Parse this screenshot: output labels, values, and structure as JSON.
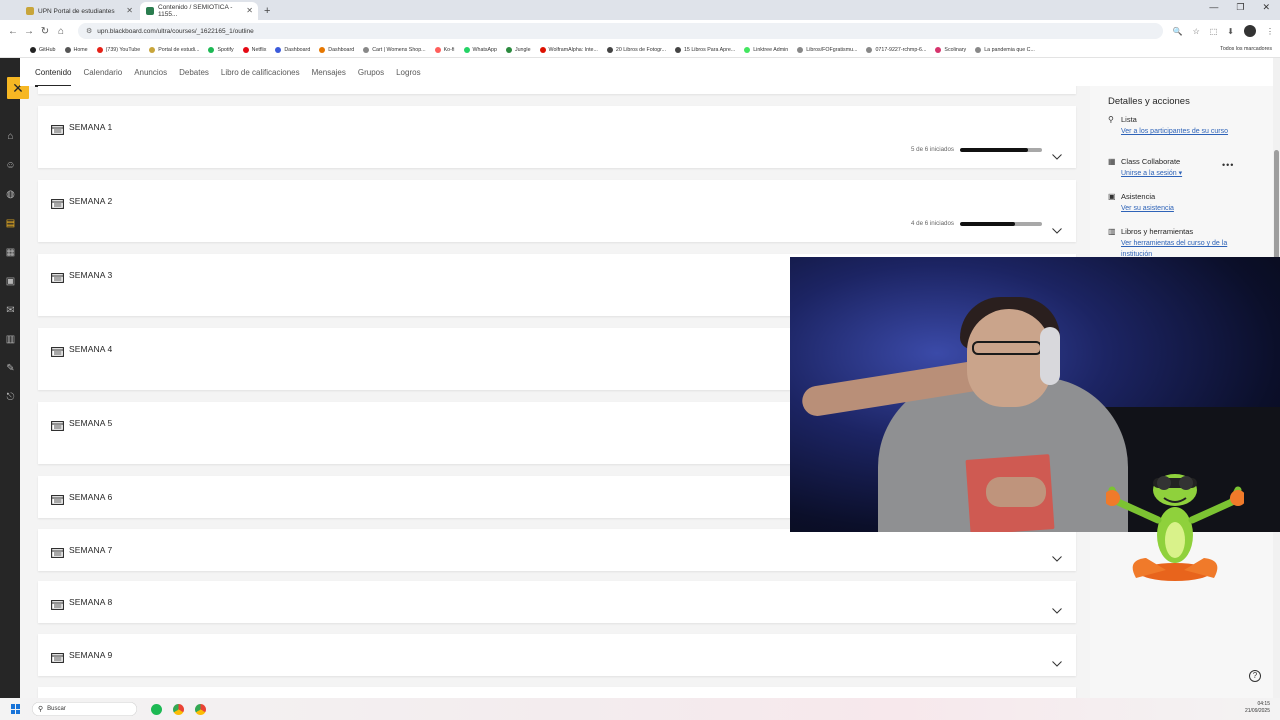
{
  "browser": {
    "tabs": [
      {
        "title": "UPN Portal de estudiantes",
        "color": "#c8a53a"
      },
      {
        "title": "Contenido / SEMIOTICA - 1155...",
        "color": "#2a7d4f"
      }
    ],
    "url": "upn.blackboard.com/ultra/courses/_1622165_1/outline",
    "bookmarks": [
      {
        "label": "GitHub",
        "color": "#222222"
      },
      {
        "label": "Home",
        "color": "#555555"
      },
      {
        "label": "(739) YouTube",
        "color": "#e62117"
      },
      {
        "label": "Portal de estudi...",
        "color": "#c8a53a"
      },
      {
        "label": "Spotify",
        "color": "#1db954"
      },
      {
        "label": "Netflix",
        "color": "#e50914"
      },
      {
        "label": "Dashboard",
        "color": "#3b5bdb"
      },
      {
        "label": "Dashboard",
        "color": "#e67700"
      },
      {
        "label": "Cart | Womens Shop...",
        "color": "#888888"
      },
      {
        "label": "Ko-fi",
        "color": "#ff5e5b"
      },
      {
        "label": "WhatsApp",
        "color": "#25d366"
      },
      {
        "label": "Jungle",
        "color": "#2b8a3e"
      },
      {
        "label": "WolframAlpha: Inte...",
        "color": "#dd1100"
      },
      {
        "label": "20 Libros de Fotogr...",
        "color": "#444444"
      },
      {
        "label": "15 Libros Para Apre...",
        "color": "#444444"
      },
      {
        "label": "Linktree Admin",
        "color": "#43e660"
      },
      {
        "label": "Libros/FOFgratismu...",
        "color": "#888888"
      },
      {
        "label": "0717-9227-rchmp-6...",
        "color": "#888888"
      },
      {
        "label": "Scolinary",
        "color": "#d6336c"
      },
      {
        "label": "La pandemia que C...",
        "color": "#888888"
      }
    ],
    "all_bookmarks": "Todos los marcadores"
  },
  "course_nav": [
    "Contenido",
    "Calendario",
    "Anuncios",
    "Debates",
    "Libro de calificaciones",
    "Mensajes",
    "Grupos",
    "Logros"
  ],
  "weeks": [
    {
      "title": "SEMANA 1",
      "progress_text": "5 de 6 iniciados",
      "progress": 0.83
    },
    {
      "title": "SEMANA 2",
      "progress_text": "4 de 6 iniciados",
      "progress": 0.67
    },
    {
      "title": "SEMANA 3"
    },
    {
      "title": "SEMANA 4"
    },
    {
      "title": "SEMANA 5"
    },
    {
      "title": "SEMANA 6"
    },
    {
      "title": "SEMANA 7"
    },
    {
      "title": "SEMANA 8"
    },
    {
      "title": "SEMANA 9"
    }
  ],
  "details": {
    "title": "Detalles y acciones",
    "items": [
      {
        "heading": "Lista",
        "link": "Ver a los participantes de su curso",
        "icon": "person-icon"
      },
      {
        "heading": "Class Collaborate",
        "link": "Unirse a la sesión ▾",
        "icon": "collaborate-icon"
      },
      {
        "heading": "Asistencia",
        "link": "Ver su asistencia",
        "icon": "attendance-icon"
      },
      {
        "heading": "Libros y herramientas",
        "link": "Ver herramientas del curso y de la institución",
        "icon": "books-icon"
      }
    ],
    "more": "•••"
  },
  "taskbar": {
    "search_placeholder": "Buscar",
    "time": "04:15",
    "date": "21/09/2025"
  },
  "rail_footer": "Priv\nCon\nAcce",
  "colors": {
    "accent": "#f6b723",
    "rail": "#262626",
    "link": "#2e63b8",
    "progress": "#111111"
  }
}
